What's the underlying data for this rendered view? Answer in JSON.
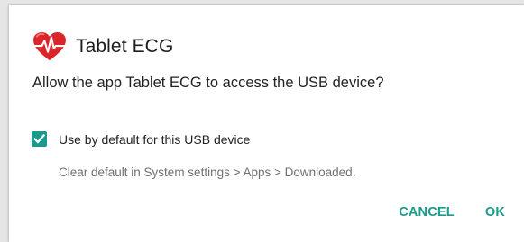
{
  "dialog": {
    "app_icon": "heart-ecg-icon",
    "title": "Tablet ECG",
    "message": "Allow the app Tablet ECG to access the USB device?",
    "checkbox": {
      "checked": true,
      "label": "Use by default for this USB device"
    },
    "hint": "Clear default in System settings > Apps > Downloaded.",
    "buttons": {
      "cancel_label": "CANCEL",
      "ok_label": "OK"
    }
  },
  "colors": {
    "accent": "#1a9a8c",
    "heart": "#d9262b",
    "background": "#ffffff"
  }
}
